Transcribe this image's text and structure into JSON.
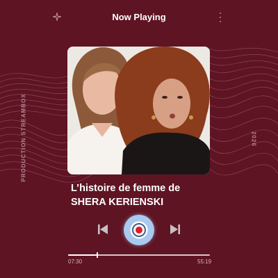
{
  "header": {
    "title": "Now Playing",
    "left_icon": "sparkle-icon",
    "right_icon": "more-vertical-icon"
  },
  "side_text": {
    "left": "PRODUCTION STREAMBOX",
    "right": "2026"
  },
  "episode": {
    "title_line1": "L’histoire de femme de",
    "title_line2": "SHERA KERIENSKI"
  },
  "controls": {
    "prev_icon": "skip-previous-icon",
    "play_icon": "record-play-icon",
    "next_icon": "skip-next-icon"
  },
  "progress": {
    "elapsed": "07:30",
    "total": "55:19",
    "fraction": 0.2
  },
  "colors": {
    "background": "#5e1423",
    "accent_red": "#e21b23",
    "accent_blue": "#a9c9ee",
    "text": "#ffffff"
  }
}
